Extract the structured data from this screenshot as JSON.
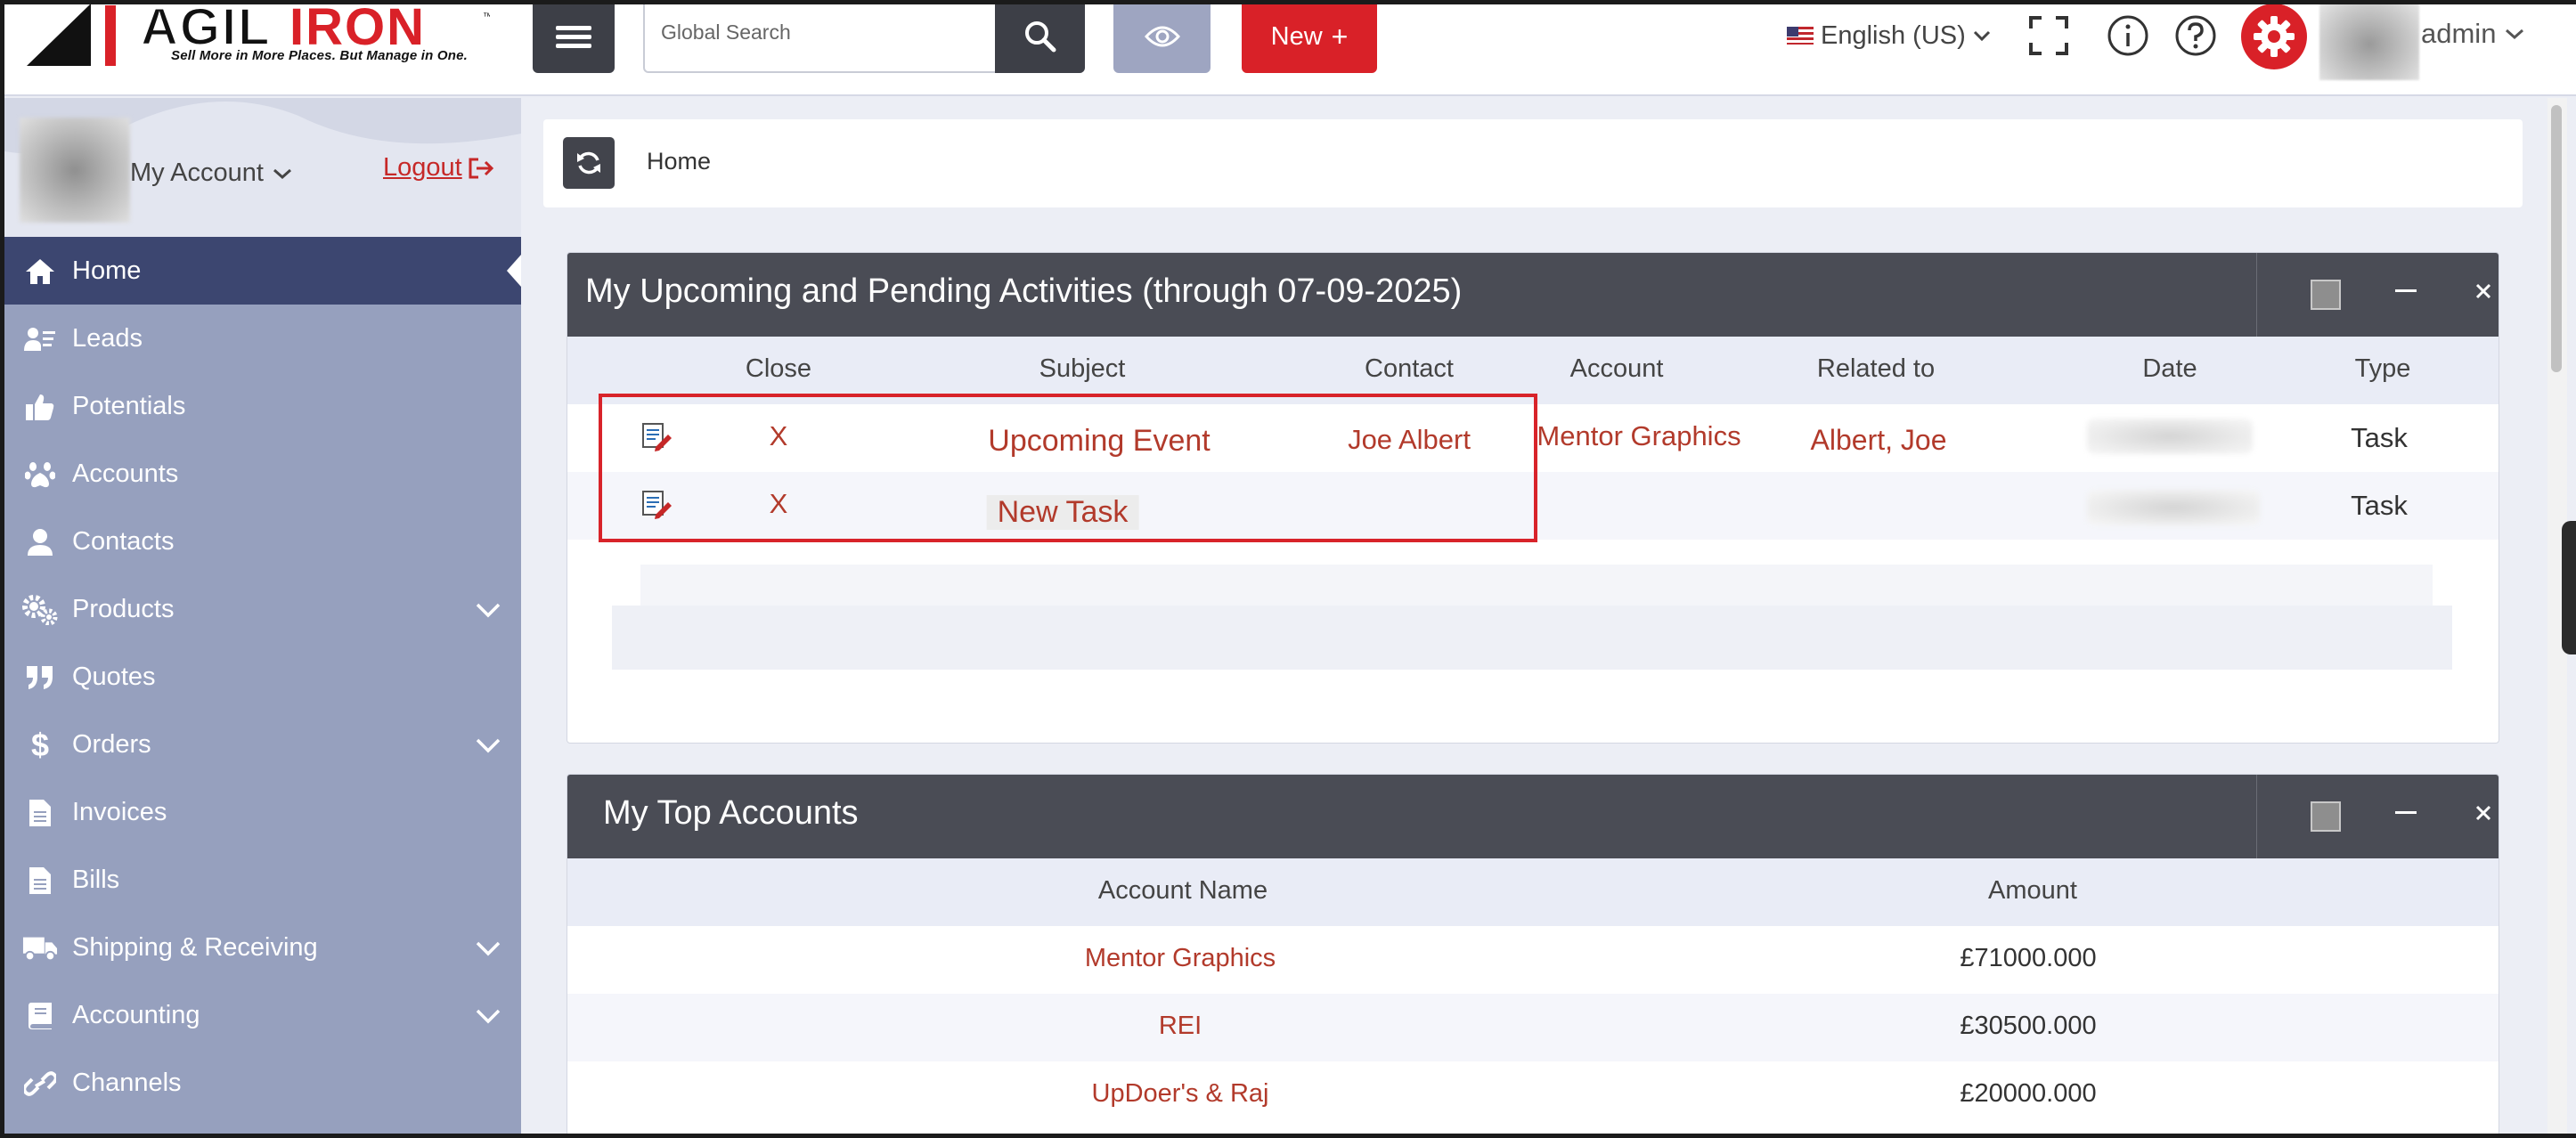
{
  "header": {
    "brand": "AGILIRON",
    "tagline": "Sell More in More Places. But Manage in One.",
    "search_placeholder": "Global Search",
    "new_button": "New",
    "language": "English (US)",
    "user": "admin"
  },
  "sidebar": {
    "account_label": "My Account",
    "logout_label": "Logout",
    "items": [
      {
        "label": "Home",
        "icon": "home-icon",
        "active": true,
        "expandable": false
      },
      {
        "label": "Leads",
        "icon": "leads-icon",
        "active": false,
        "expandable": false
      },
      {
        "label": "Potentials",
        "icon": "thumbs-up-icon",
        "active": false,
        "expandable": false
      },
      {
        "label": "Accounts",
        "icon": "paw-icon",
        "active": false,
        "expandable": false
      },
      {
        "label": "Contacts",
        "icon": "user-icon",
        "active": false,
        "expandable": false
      },
      {
        "label": "Products",
        "icon": "cogs-icon",
        "active": false,
        "expandable": true
      },
      {
        "label": "Quotes",
        "icon": "quote-icon",
        "active": false,
        "expandable": false
      },
      {
        "label": "Orders",
        "icon": "dollar-icon",
        "active": false,
        "expandable": true
      },
      {
        "label": "Invoices",
        "icon": "document-icon",
        "active": false,
        "expandable": false
      },
      {
        "label": "Bills",
        "icon": "document-icon",
        "active": false,
        "expandable": false
      },
      {
        "label": "Shipping & Receiving",
        "icon": "truck-icon",
        "active": false,
        "expandable": true
      },
      {
        "label": "Accounting",
        "icon": "book-icon",
        "active": false,
        "expandable": true
      },
      {
        "label": "Channels",
        "icon": "link-icon",
        "active": false,
        "expandable": false
      }
    ]
  },
  "breadcrumb": {
    "home": "Home"
  },
  "activities": {
    "title": "My Upcoming and Pending Activities (through 07-09-2025)",
    "columns": [
      "Close",
      "Subject",
      "Contact",
      "Account",
      "Related to",
      "Date",
      "Type"
    ],
    "rows": [
      {
        "close": "X",
        "subject": "Upcoming Event",
        "contact": "Joe Albert",
        "account": "Mentor Graphics",
        "related_to": "Albert, Joe",
        "type": "Task"
      },
      {
        "close": "X",
        "subject": "New Task",
        "contact": "",
        "account": "",
        "related_to": "",
        "type": "Task"
      }
    ]
  },
  "top_accounts": {
    "title": "My Top Accounts",
    "columns": [
      "Account Name",
      "Amount"
    ],
    "rows": [
      {
        "name": "Mentor Graphics",
        "amount": "£71000.000"
      },
      {
        "name": "REI",
        "amount": "£30500.000"
      },
      {
        "name": "UpDoer's & Raj",
        "amount": "£20000.000"
      }
    ]
  },
  "colors": {
    "brand_red": "#d92128",
    "sidebar_bg": "#96a0be",
    "sidebar_active": "#3c4670",
    "panel_header": "#4a4c55",
    "link_red": "#b23a2b"
  }
}
